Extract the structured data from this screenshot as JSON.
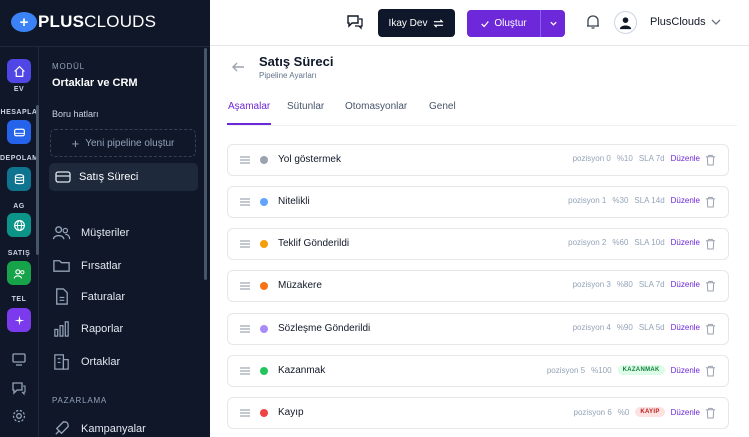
{
  "brand": {
    "mark": "+",
    "name_bold": "PLUS",
    "name_light": "CLOUDS"
  },
  "rail": {
    "items": [
      {
        "label": "EV",
        "color": "#4f46e5"
      },
      {
        "label": "HESAPLA",
        "color": "#2563eb"
      },
      {
        "label": "DEPOLAMA",
        "color": "#0e7490"
      },
      {
        "label": "AĞ",
        "color": "#0d9488"
      },
      {
        "label": "SATIŞ",
        "color": "#16a34a"
      },
      {
        "label": "TEL",
        "color": "#7c3aed"
      }
    ]
  },
  "module": {
    "label": "MODÜL",
    "title": "Ortaklar ve CRM"
  },
  "pipelines": {
    "label": "Boru hatları",
    "new_label": "Yeni pipeline oluştur",
    "active_label": "Satış Süreci"
  },
  "nav": {
    "items": [
      {
        "label": "Müşteriler",
        "icon": "users-icon"
      },
      {
        "label": "Fırsatlar",
        "icon": "folder-icon"
      },
      {
        "label": "Faturalar",
        "icon": "file-icon"
      },
      {
        "label": "Raporlar",
        "icon": "bar-chart-icon"
      },
      {
        "label": "Ortaklar",
        "icon": "building-icon"
      }
    ],
    "section_label": "PAZARLAMA",
    "section_item": "Kampanyalar"
  },
  "header": {
    "team_label": "Ikay Dev",
    "create_label": "Oluştur",
    "user_name": "PlusClouds"
  },
  "page": {
    "title": "Satış Süreci",
    "subtitle": "Pipeline Ayarları"
  },
  "tabs": [
    {
      "label": "Aşamalar",
      "active": true
    },
    {
      "label": "Sütunlar",
      "active": false
    },
    {
      "label": "Otomasyonlar",
      "active": false
    },
    {
      "label": "Genel",
      "active": false
    }
  ],
  "stages": [
    {
      "name": "Yol göstermek",
      "color": "#9ca3af",
      "position": "pozisyon 0",
      "percent": "%10",
      "sla": "SLA 7d",
      "badge": "",
      "edit": "Düzenle"
    },
    {
      "name": "Nitelikli",
      "color": "#60a5fa",
      "position": "pozisyon 1",
      "percent": "%30",
      "sla": "SLA 14d",
      "badge": "",
      "edit": "Düzenle"
    },
    {
      "name": "Teklif Gönderildi",
      "color": "#f59e0b",
      "position": "pozisyon 2",
      "percent": "%60",
      "sla": "SLA 10d",
      "badge": "",
      "edit": "Düzenle"
    },
    {
      "name": "Müzakere",
      "color": "#f97316",
      "position": "pozisyon 3",
      "percent": "%80",
      "sla": "SLA 7d",
      "badge": "",
      "edit": "Düzenle"
    },
    {
      "name": "Sözleşme Gönderildi",
      "color": "#a78bfa",
      "position": "pozisyon 4",
      "percent": "%90",
      "sla": "SLA 5d",
      "badge": "",
      "edit": "Düzenle"
    },
    {
      "name": "Kazanmak",
      "color": "#22c55e",
      "position": "pozisyon 5",
      "percent": "%100",
      "sla": "",
      "badge": "KAZANMAK",
      "edit": "Düzenle"
    },
    {
      "name": "Kayıp",
      "color": "#ef4444",
      "position": "pozisyon 6",
      "percent": "%0",
      "sla": "",
      "badge": "KAYIP",
      "edit": "Düzenle"
    }
  ]
}
